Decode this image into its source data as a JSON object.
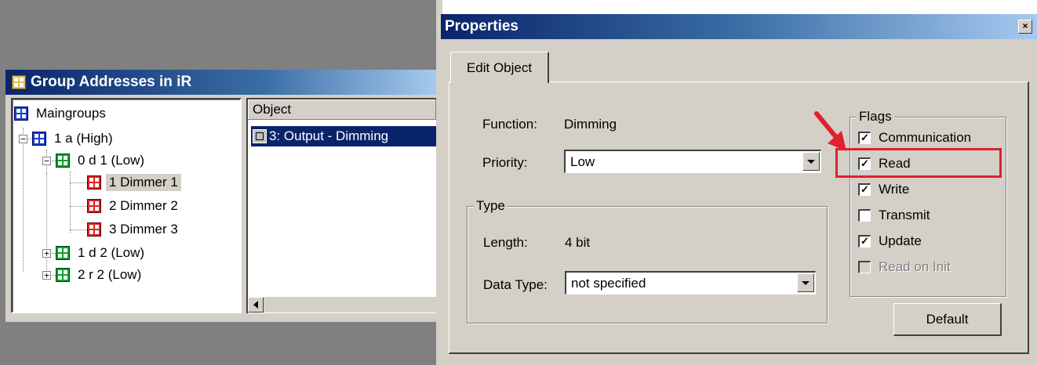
{
  "group_window": {
    "title": "Group Addresses in iR",
    "tree": [
      {
        "label": "Maingroups",
        "icon": "group-icon-blue"
      },
      {
        "label": "1 a (High)",
        "icon": "group-icon-blue",
        "expander": "−"
      },
      {
        "label": "0 d 1 (Low)",
        "icon": "group-icon-green",
        "expander": "−"
      },
      {
        "label": "1 Dimmer 1",
        "icon": "group-icon-red",
        "selected": true
      },
      {
        "label": "2 Dimmer 2",
        "icon": "group-icon-red"
      },
      {
        "label": "3 Dimmer 3",
        "icon": "group-icon-red"
      },
      {
        "label": "1 d 2 (Low)",
        "icon": "group-icon-green",
        "expander": "+"
      },
      {
        "label": "2 r 2 (Low)",
        "icon": "group-icon-green",
        "expander": "+"
      }
    ],
    "list": {
      "column_header": "Object",
      "items": [
        {
          "label": "3: Output - Dimming"
        }
      ]
    }
  },
  "properties_dialog": {
    "title": "Properties",
    "close_glyph": "×",
    "tab_label": "Edit Object",
    "function_label": "Function:",
    "function_value": "Dimming",
    "priority_label": "Priority:",
    "priority_value": "Low",
    "type_group_label": "Type",
    "length_label": "Length:",
    "length_value": "4 bit",
    "data_type_label": "Data Type:",
    "data_type_value": "not specified",
    "flags_label": "Flags",
    "flags": [
      {
        "label": "Communication",
        "checked": true,
        "enabled": true
      },
      {
        "label": "Read",
        "checked": true,
        "enabled": true
      },
      {
        "label": "Write",
        "checked": true,
        "enabled": true
      },
      {
        "label": "Transmit",
        "checked": false,
        "enabled": true
      },
      {
        "label": "Update",
        "checked": true,
        "enabled": true
      },
      {
        "label": "Read on Init",
        "checked": false,
        "enabled": false
      }
    ],
    "default_button": "Default",
    "annotation_color": "#e02030"
  }
}
